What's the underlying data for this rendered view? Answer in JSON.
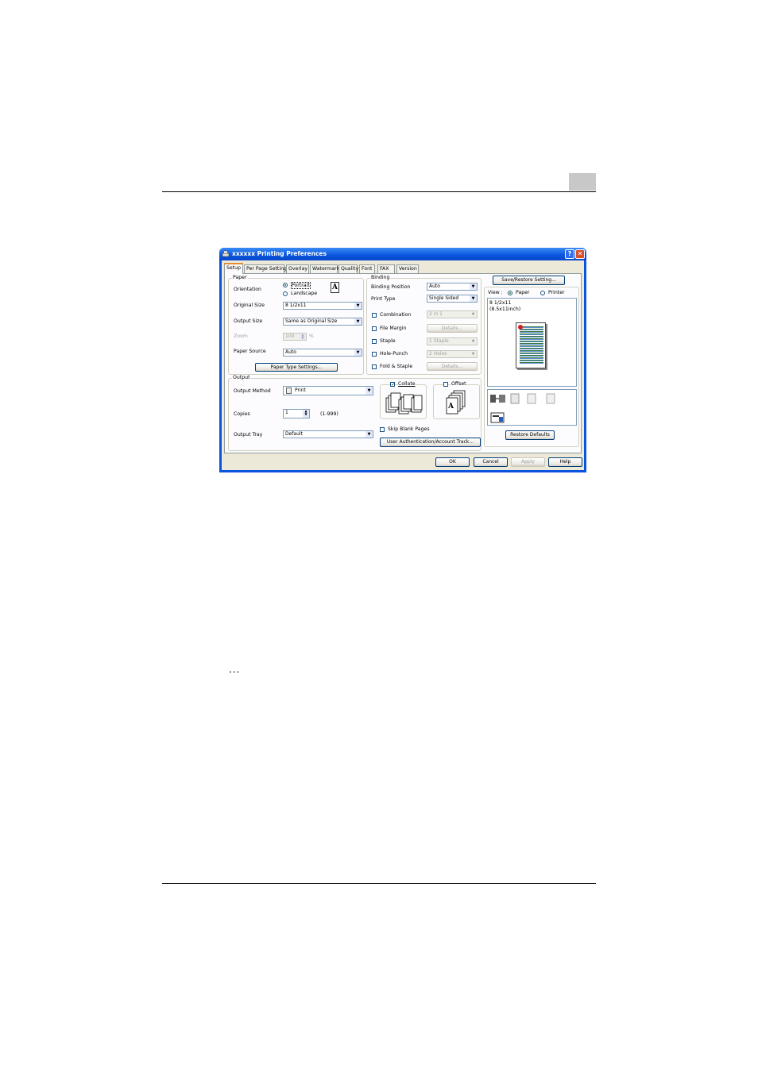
{
  "dialog": {
    "title": "xxxxxx Printing Preferences",
    "help_label": "?",
    "close_label": "✕",
    "tabs": [
      {
        "label": "Setup"
      },
      {
        "label": "Per Page Setting"
      },
      {
        "label": "Overlay"
      },
      {
        "label": "Watermark"
      },
      {
        "label": "Quality"
      },
      {
        "label": "Font"
      },
      {
        "label": "FAX"
      },
      {
        "label": "Version"
      }
    ],
    "paper": {
      "group_label": "Paper",
      "orientation_label": "Orientation",
      "portrait_label": "Portrait",
      "landscape_label": "Landscape",
      "orientation_preview": "A",
      "original_size_label": "Original Size",
      "original_size_value": "8 1/2x11",
      "output_size_label": "Output Size",
      "output_size_value": "Same as Original Size",
      "zoom_label": "Zoom",
      "zoom_value": "100",
      "zoom_unit": "%",
      "paper_source_label": "Paper Source",
      "paper_source_value": "Auto",
      "paper_type_button": "Paper Type Settings..."
    },
    "binding": {
      "group_label": "Binding",
      "binding_position_label": "Binding Position",
      "binding_position_value": "Auto",
      "print_type_label": "Print Type",
      "print_type_value": "Single Sided",
      "combination_label": "Combination",
      "combination_value": "2 in 1",
      "file_margin_label": "File Margin",
      "details_label": "Details...",
      "staple_label": "Staple",
      "staple_value": "1 Staple",
      "hole_punch_label": "Hole-Punch",
      "hole_punch_value": "2 Holes",
      "fold_staple_label": "Fold & Staple"
    },
    "output": {
      "group_label": "Output",
      "output_method_label": "Output Method",
      "output_method_value": "Print",
      "copies_label": "Copies",
      "copies_value": "1",
      "copies_range": "(1-999)",
      "output_tray_label": "Output Tray",
      "output_tray_value": "Default",
      "collate_label": "Collate",
      "offset_label": "Offset",
      "offset_preview": "A",
      "skip_blank_label": "Skip Blank Pages",
      "user_auth_button": "User Authentication/Account Track..."
    },
    "right": {
      "save_restore_button": "Save/Restore Setting...",
      "view_label": "View :",
      "paper_option": "Paper",
      "printer_option": "Printer",
      "preview_size": "8 1/2x11",
      "preview_size_sub": "(8.5x11inch)",
      "restore_defaults_button": "Restore Defaults"
    },
    "footer": {
      "ok": "OK",
      "cancel": "Cancel",
      "apply": "Apply",
      "help": "Help"
    }
  },
  "page": {
    "ellipsis": "..."
  }
}
